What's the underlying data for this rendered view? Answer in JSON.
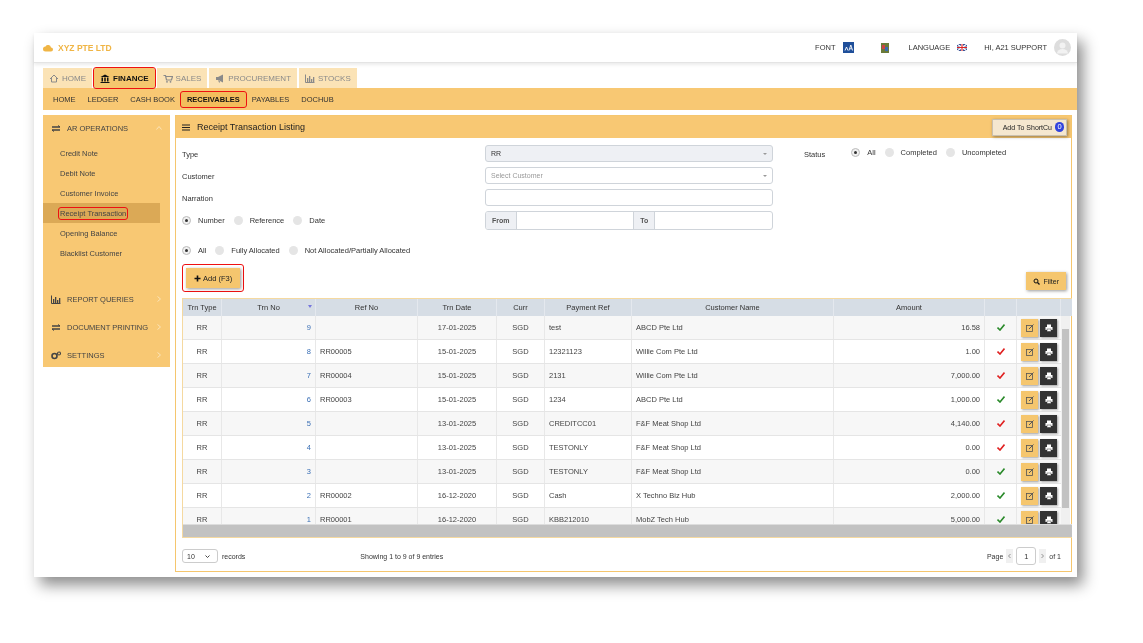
{
  "brand": "XYZ PTE LTD",
  "header": {
    "font_label": "FONT",
    "language_label": "LANGUAGE",
    "user": "HI, A21 SUPPORT"
  },
  "modules": [
    {
      "label": "HOME",
      "selected": false,
      "highlighted": false
    },
    {
      "label": "FINANCE",
      "selected": true,
      "highlighted": true
    },
    {
      "label": "SALES",
      "selected": false,
      "highlighted": false
    },
    {
      "label": "PROCUREMENT",
      "selected": false,
      "highlighted": false
    },
    {
      "label": "STOCKS",
      "selected": false,
      "highlighted": false
    }
  ],
  "subnav": [
    {
      "label": "HOME",
      "selected": false,
      "highlighted": false
    },
    {
      "label": "LEDGER",
      "selected": false,
      "highlighted": false
    },
    {
      "label": "CASH BOOK",
      "selected": false,
      "highlighted": false
    },
    {
      "label": "RECEIVABLES",
      "selected": true,
      "highlighted": true
    },
    {
      "label": "PAYABLES",
      "selected": false,
      "highlighted": false
    },
    {
      "label": "DOCHUB",
      "selected": false,
      "highlighted": false
    }
  ],
  "sidebar": [
    {
      "title": "AR OPERATIONS",
      "expanded": true,
      "items": [
        {
          "label": "Credit Note",
          "selected": false,
          "highlighted": false
        },
        {
          "label": "Debit Note",
          "selected": false,
          "highlighted": false
        },
        {
          "label": "Customer Invoice",
          "selected": false,
          "highlighted": false
        },
        {
          "label": "Receipt Transaction",
          "selected": true,
          "highlighted": true
        },
        {
          "label": "Opening Balance",
          "selected": false,
          "highlighted": false
        },
        {
          "label": "Blacklist Customer",
          "selected": false,
          "highlighted": false
        }
      ]
    },
    {
      "title": "REPORT QUERIES",
      "expanded": false
    },
    {
      "title": "DOCUMENT PRINTING",
      "expanded": false
    },
    {
      "title": "SETTINGS",
      "expanded": false
    }
  ],
  "panel": {
    "title": "Receipt Transaction Listing",
    "shortcut_button": "Add To ShortCu",
    "shortcut_count": "0",
    "type": {
      "label": "Type",
      "value": "RR"
    },
    "customer": {
      "label": "Customer",
      "placeholder": "Select Customer"
    },
    "narration": {
      "label": "Narration"
    },
    "search_by": [
      {
        "label": "Number",
        "selected": true
      },
      {
        "label": "Reference",
        "selected": false
      },
      {
        "label": "Date",
        "selected": false
      }
    ],
    "range": {
      "from_label": "From",
      "to_label": "To"
    },
    "allocation": [
      {
        "label": "All",
        "selected": true
      },
      {
        "label": "Fully Allocated",
        "selected": false
      },
      {
        "label": "Not Allocated/Partially Allocated",
        "selected": false
      }
    ],
    "status": {
      "label": "Status",
      "options": [
        {
          "label": "All",
          "selected": true
        },
        {
          "label": "Completed",
          "selected": false
        },
        {
          "label": "Uncompleted",
          "selected": false
        }
      ]
    },
    "add_button": {
      "label": "Add (F3)",
      "highlighted": true
    },
    "filter_button": "Filter"
  },
  "table": {
    "columns": [
      {
        "label": "Trn Type",
        "sorted": false
      },
      {
        "label": "Trn No",
        "sorted": true
      },
      {
        "label": "Ref No",
        "sorted": false
      },
      {
        "label": "Trn Date",
        "sorted": false
      },
      {
        "label": "Curr",
        "sorted": false
      },
      {
        "label": "Payment Ref",
        "sorted": false
      },
      {
        "label": "Customer Name",
        "sorted": false
      },
      {
        "label": "Amount",
        "sorted": false
      }
    ],
    "rows": [
      {
        "type": "RR",
        "no": "9",
        "ref": "",
        "date": "17-01-2025",
        "curr": "SGD",
        "payment_ref": "test",
        "customer": "ABCD Pte Ltd",
        "amount": "16.58",
        "color": "#2a8a2a"
      },
      {
        "type": "RR",
        "no": "8",
        "ref": "RR00005",
        "date": "15-01-2025",
        "curr": "SGD",
        "payment_ref": "12321123",
        "customer": "Willie Com Pte Ltd",
        "amount": "1.00",
        "color": "#e02020"
      },
      {
        "type": "RR",
        "no": "7",
        "ref": "RR00004",
        "date": "15-01-2025",
        "curr": "SGD",
        "payment_ref": "2131",
        "customer": "Willie Com Pte Ltd",
        "amount": "7,000.00",
        "color": "#e02020"
      },
      {
        "type": "RR",
        "no": "6",
        "ref": "RR00003",
        "date": "15-01-2025",
        "curr": "SGD",
        "payment_ref": "1234",
        "customer": "ABCD Pte Ltd",
        "amount": "1,000.00",
        "color": "#2a8a2a"
      },
      {
        "type": "RR",
        "no": "5",
        "ref": "",
        "date": "13-01-2025",
        "curr": "SGD",
        "payment_ref": "CREDITCC01",
        "customer": "F&F Meat Shop Ltd",
        "amount": "4,140.00",
        "color": "#e02020"
      },
      {
        "type": "RR",
        "no": "4",
        "ref": "",
        "date": "13-01-2025",
        "curr": "SGD",
        "payment_ref": "TESTONLY",
        "customer": "F&F Meat Shop Ltd",
        "amount": "0.00",
        "color": "#e02020"
      },
      {
        "type": "RR",
        "no": "3",
        "ref": "",
        "date": "13-01-2025",
        "curr": "SGD",
        "payment_ref": "TESTONLY",
        "customer": "F&F Meat Shop Ltd",
        "amount": "0.00",
        "color": "#2a8a2a"
      },
      {
        "type": "RR",
        "no": "2",
        "ref": "RR00002",
        "date": "16-12-2020",
        "curr": "SGD",
        "payment_ref": "Cash",
        "customer": "X Techno Biz Hub",
        "amount": "2,000.00",
        "color": "#2a8a2a"
      },
      {
        "type": "RR",
        "no": "1",
        "ref": "RR00001",
        "date": "16-12-2020",
        "curr": "SGD",
        "payment_ref": "KBB212010",
        "customer": "MobZ Tech Hub",
        "amount": "5,000.00",
        "color": "#2a8a2a"
      }
    ]
  },
  "footer": {
    "page_size": "10",
    "records_label": "records",
    "info": "Showing 1 to 9 of 9 entries",
    "page_label": "Page",
    "page": "1",
    "page_total": "of 1"
  }
}
